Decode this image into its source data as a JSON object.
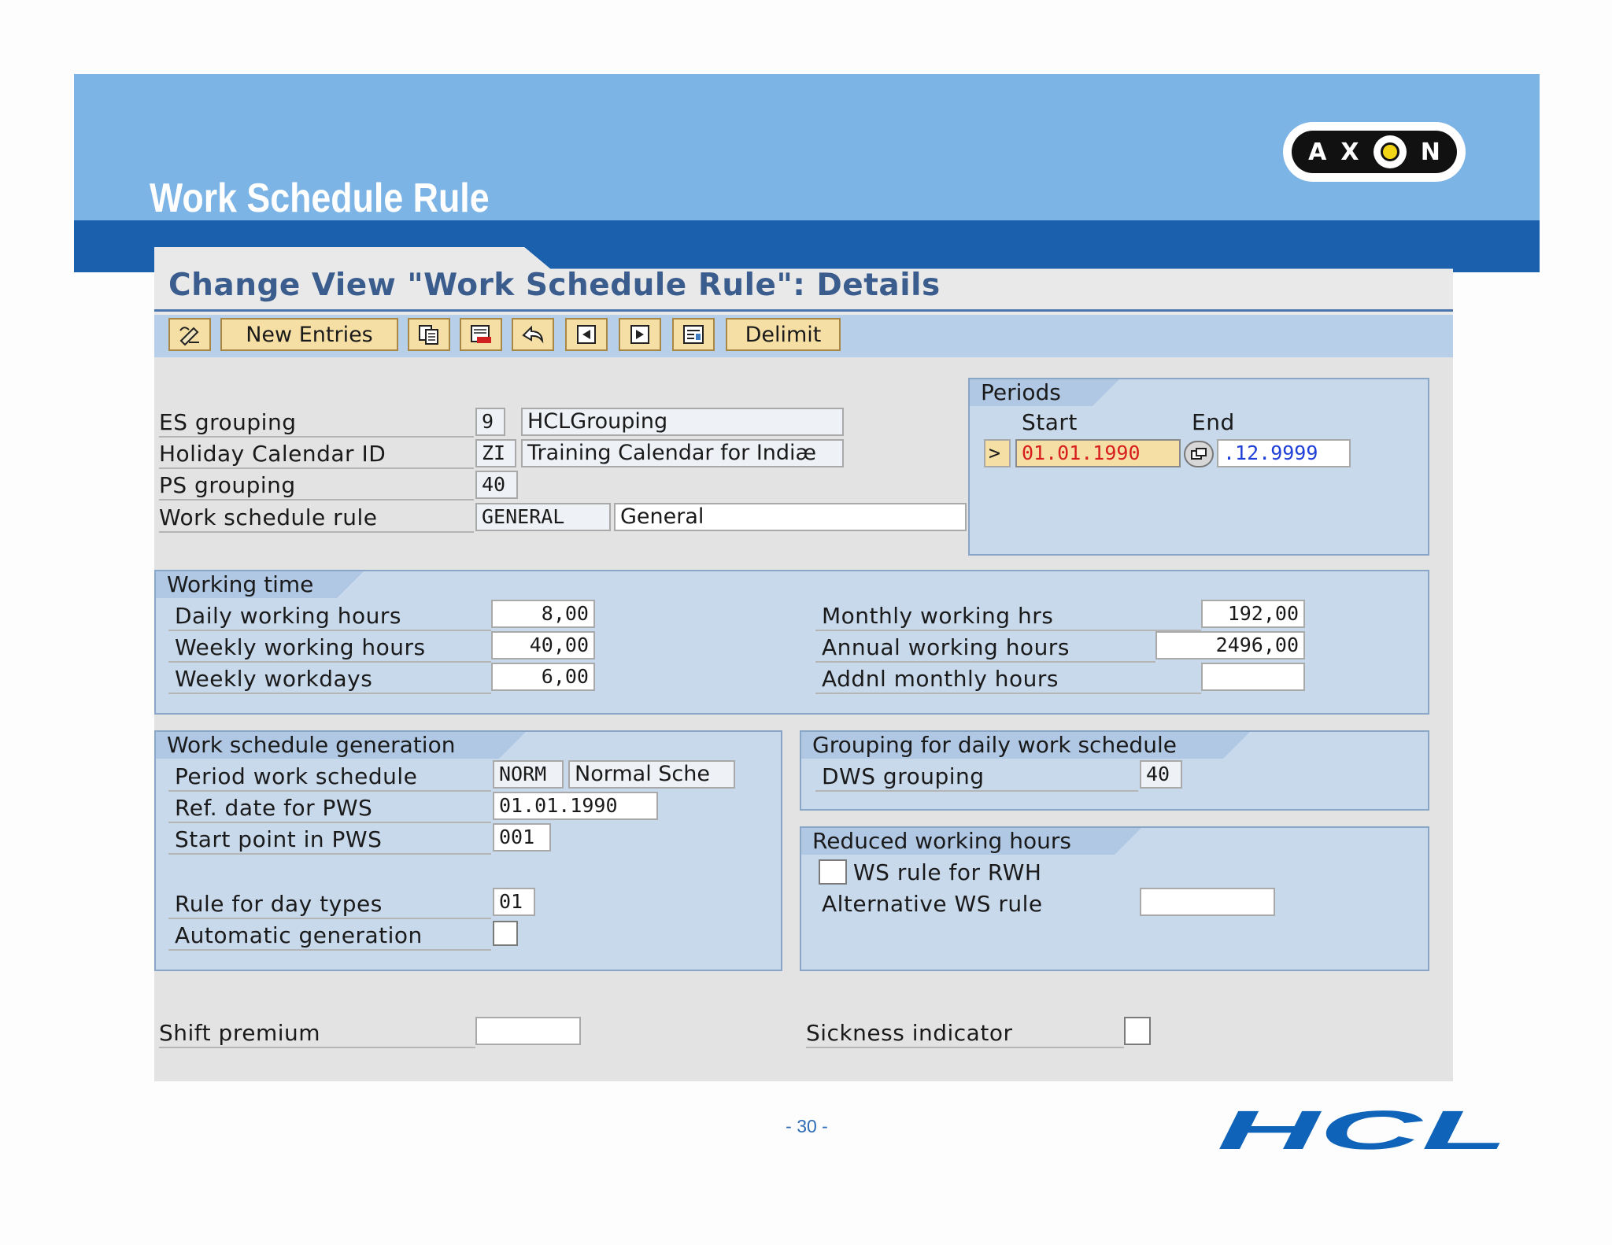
{
  "slide": {
    "title": "Work Schedule Rule",
    "page_number": "- 30 -"
  },
  "logos": {
    "axon": {
      "letters": [
        "A",
        "X",
        "N"
      ]
    },
    "hcl": "HCL"
  },
  "view": {
    "title": "Change View \"Work Schedule Rule\": Details"
  },
  "toolbar": {
    "new_entries": "New Entries",
    "delimit": "Delimit",
    "icons": [
      "display-change-icon",
      "copy-icon",
      "delete-icon",
      "undo-change-icon",
      "previous-entry-icon",
      "next-entry-icon",
      "transport-icon"
    ]
  },
  "header": {
    "es_grouping": {
      "label": "ES grouping",
      "value": "9",
      "text": "HCLGrouping"
    },
    "holiday_calendar": {
      "label": "Holiday Calendar ID",
      "value": "ZI",
      "text": "Training Calendar for Indiæ"
    },
    "ps_grouping": {
      "label": "PS grouping",
      "value": "40"
    },
    "ws_rule": {
      "label": "Work schedule rule",
      "value": "GENERAL",
      "text": "General"
    }
  },
  "periods": {
    "title": "Periods",
    "start_label": "Start",
    "end_label": "End",
    "start_value": "01.01.1990",
    "end_value": ".12.9999"
  },
  "working_time": {
    "title": "Working time",
    "daily_hours": {
      "label": "Daily working hours",
      "value": "8,00"
    },
    "weekly_hours": {
      "label": "Weekly working hours",
      "value": "40,00"
    },
    "weekly_workdays": {
      "label": "Weekly workdays",
      "value": "6,00"
    },
    "monthly_hrs": {
      "label": "Monthly working hrs",
      "value": "192,00"
    },
    "annual_hours": {
      "label": "Annual working hours",
      "value": "2496,00"
    },
    "addnl_monthly": {
      "label": "Addnl monthly hours",
      "value": ""
    }
  },
  "ws_generation": {
    "title": "Work schedule generation",
    "period_ws": {
      "label": "Period work schedule",
      "value": "NORM",
      "text": "Normal Sche"
    },
    "ref_date": {
      "label": "Ref. date for PWS",
      "value": "01.01.1990"
    },
    "start_point": {
      "label": "Start point in PWS",
      "value": "001"
    },
    "day_types": {
      "label": "Rule for day types",
      "value": "01"
    },
    "auto_generation": {
      "label": "Automatic generation",
      "checked": false
    }
  },
  "dws_grouping": {
    "title": "Grouping for daily work schedule",
    "dws": {
      "label": "DWS grouping",
      "value": "40"
    }
  },
  "reduced_hours": {
    "title": "Reduced working hours",
    "ws_rule_rwh": {
      "label": "WS rule for RWH",
      "checked": false
    },
    "alt_ws_rule": {
      "label": "Alternative WS rule",
      "value": ""
    }
  },
  "footer": {
    "shift_premium": {
      "label": "Shift premium",
      "value": ""
    },
    "sickness_indicator": {
      "label": "Sickness indicator",
      "checked": false
    }
  }
}
